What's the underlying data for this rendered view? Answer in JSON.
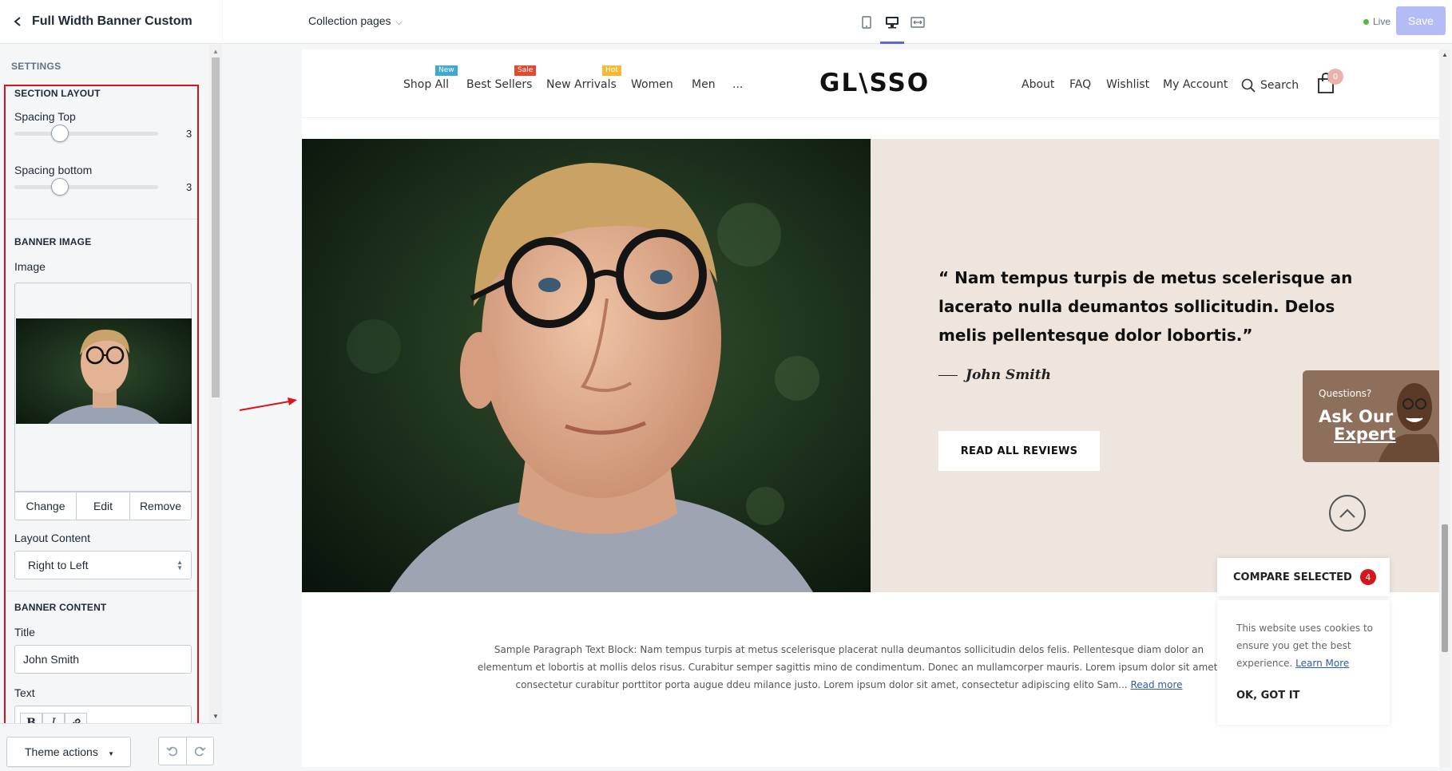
{
  "editor": {
    "title": "Full Width Banner Custom",
    "settings_label": "SETTINGS",
    "section_layout": {
      "title": "SECTION LAYOUT",
      "spacing_top_label": "Spacing Top",
      "spacing_top_value": "3",
      "spacing_bottom_label": "Spacing bottom",
      "spacing_bottom_value": "3"
    },
    "banner_image": {
      "title": "BANNER IMAGE",
      "image_label": "Image",
      "change": "Change",
      "edit": "Edit",
      "remove": "Remove",
      "layout_content_label": "Layout Content",
      "layout_content_value": "Right to Left"
    },
    "banner_content": {
      "title": "BANNER CONTENT",
      "title_label": "Title",
      "title_value": "John Smith",
      "text_label": "Text",
      "bold": "B",
      "italic": "I"
    },
    "theme_actions": "Theme actions"
  },
  "topbar": {
    "page_select": "Collection pages",
    "live": "Live",
    "save": "Save"
  },
  "store": {
    "nav_left": [
      {
        "label": "Shop All",
        "badge": "New",
        "badge_color": "#3fa9d6"
      },
      {
        "label": "Best Sellers",
        "badge": "Sale",
        "badge_color": "#e2492d"
      },
      {
        "label": "New Arrivals",
        "badge": "Hot",
        "badge_color": "#f4b935"
      },
      {
        "label": "Women"
      },
      {
        "label": "Men"
      },
      {
        "label": "..."
      }
    ],
    "logo": "GL\\SSO",
    "nav_right": [
      "About",
      "FAQ",
      "Wishlist",
      "My Account",
      "Search"
    ],
    "cart_count": "0"
  },
  "banner": {
    "quote": "“ Nam tempus turpis de metus scelerisque an lacerato nulla deumantos sollicitudin. Delos melis pellentesque dolor lobortis.”",
    "author": "John Smith",
    "button": "READ ALL REVIEWS"
  },
  "ask_expert": {
    "question": "Questions?",
    "line1": "Ask Our",
    "line2": "Expert"
  },
  "compare": {
    "label": "COMPARE SELECTED",
    "count": "4"
  },
  "cookie": {
    "text": "This website uses cookies to ensure you get the best experience.",
    "link": "Learn More",
    "ok": "OK, GOT IT"
  },
  "paragraph": {
    "text": "Sample Paragraph Text Block: Nam tempus turpis at metus scelerisque placerat nulla deumantos sollicitudin delos felis. Pellentesque diam dolor an elementum et lobortis at mollis delos risus. Curabitur semper sagittis mino de condimentum. Donec an mullamcorper mauris. Lorem ipsum dolor sit amet, consectetur curabitur porttitor porta augue ddeu milance justo. Lorem ipsum dolor sit amet, consectetur adipiscing elito Sam...",
    "link": "Read more"
  },
  "colors": {
    "highlight": "#d8141c",
    "banner_bg": "#ede5de",
    "save_btn": "#b3bcf5",
    "accent": "#5c6ac4"
  }
}
